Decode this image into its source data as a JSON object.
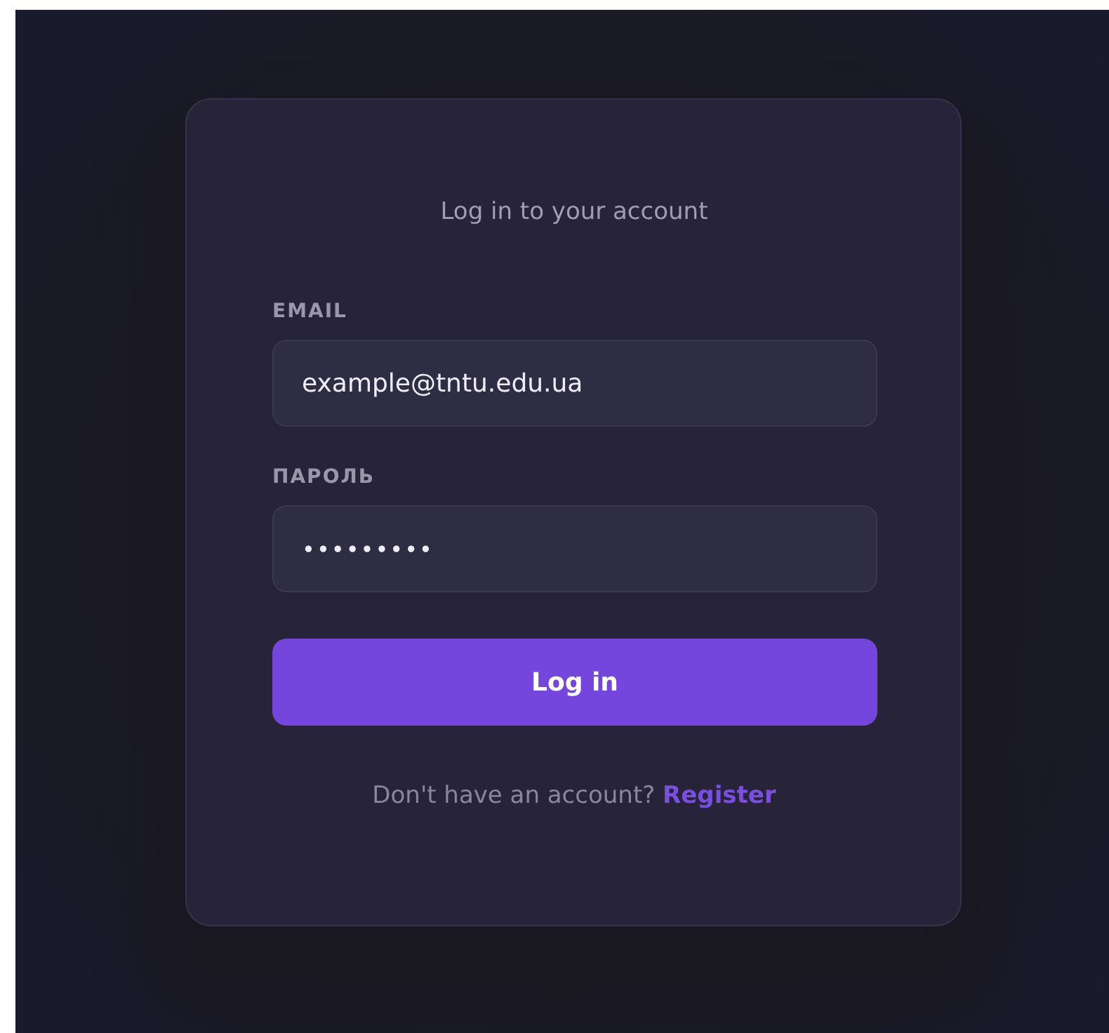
{
  "title": "Log in to your account",
  "fields": [
    {
      "label": "EMAIL",
      "value": "example@tntu.edu.ua",
      "kind": "email"
    },
    {
      "label": "ПАРОЛЬ",
      "value": "•••••••••",
      "kind": "password"
    }
  ],
  "submit": "Log in",
  "footer": {
    "text": "Don't have an account?",
    "link": "Register"
  }
}
